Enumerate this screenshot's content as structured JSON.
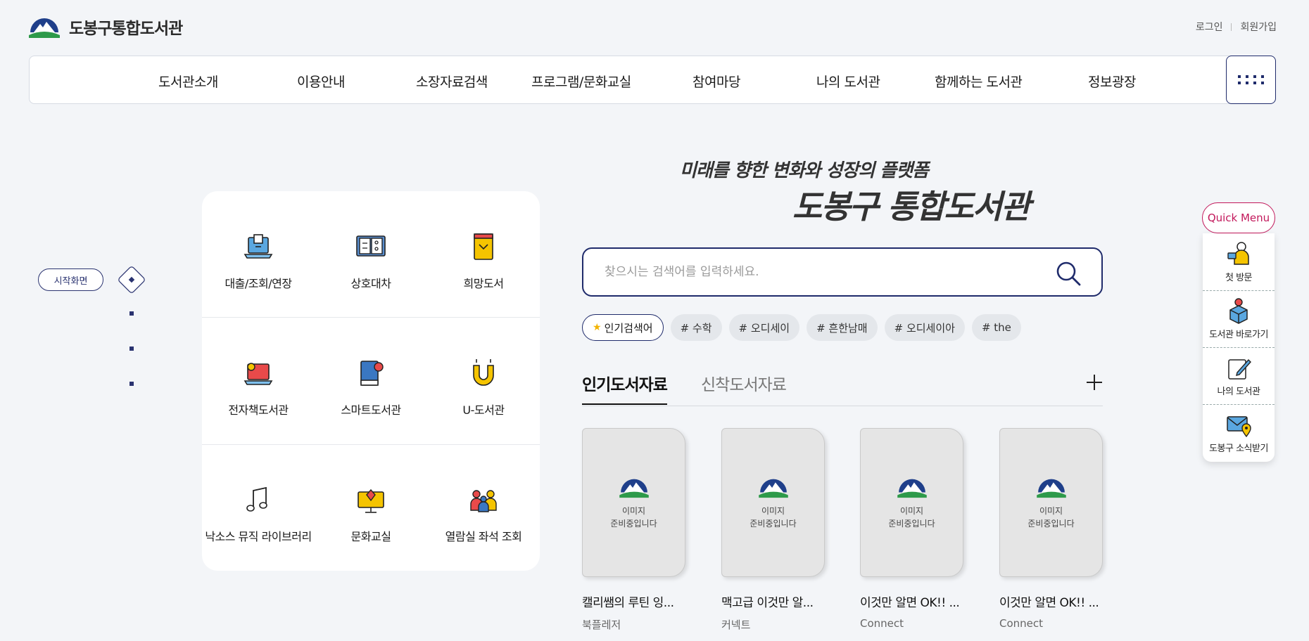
{
  "header": {
    "site_name": "도봉구통합도서관",
    "login": "로그인",
    "signup": "회원가입"
  },
  "gnb": {
    "items": [
      "도서관소개",
      "이용안내",
      "소장자료검색",
      "프로그램/문화교실",
      "참여마당",
      "나의 도서관",
      "함께하는 도서관",
      "정보광장"
    ]
  },
  "indicator": {
    "start_label": "시작화면"
  },
  "services": [
    {
      "label": "대출/조회/연장",
      "icon": "laptop-book-icon"
    },
    {
      "label": "상호대차",
      "icon": "open-book-icon"
    },
    {
      "label": "희망도서",
      "icon": "yellow-book-icon"
    },
    {
      "label": "전자책도서관",
      "icon": "ebook-device-icon"
    },
    {
      "label": "스마트도서관",
      "icon": "smart-book-icon"
    },
    {
      "label": "U-도서관",
      "icon": "magnet-icon"
    },
    {
      "label": "낙소스 뮤직 라이브러리",
      "icon": "music-note-icon"
    },
    {
      "label": "문화교실",
      "icon": "monitor-book-icon"
    },
    {
      "label": "열람실 좌석 조회",
      "icon": "people-icon"
    }
  ],
  "slogan": {
    "line1": "미래를 향한 변화와 성장의 플랫폼",
    "line2": "도봉구 통합도서관"
  },
  "search": {
    "placeholder": "찾으시는 검색어를 입력하세요."
  },
  "tags": {
    "popular_label": "인기검색어",
    "items": [
      "# 수학",
      "# 오디세이",
      "# 흔한남매",
      "# 오디세이아",
      "# the"
    ]
  },
  "tabs": {
    "active": "인기도서자료",
    "inactive": "신착도서자료"
  },
  "books": [
    {
      "title": "캘리쌤의 루틴 잉...",
      "publisher": "북플레저",
      "cover_text": "이미지\n준비중입니다"
    },
    {
      "title": "맥고급 이것만 알...",
      "publisher": "커넥트",
      "cover_text": "이미지\n준비중입니다"
    },
    {
      "title": "이것만 알면 OK!! ...",
      "publisher": "Connect",
      "cover_text": "이미지\n준비중입니다"
    },
    {
      "title": "이것만 알면 OK!! ...",
      "publisher": "Connect",
      "cover_text": "이미지\n준비중입니다"
    }
  ],
  "quick_menu": {
    "title": "Quick Menu",
    "items": [
      {
        "label": "첫 방문",
        "icon": "first-visit-icon"
      },
      {
        "label": "도서관 바로가기",
        "icon": "location-box-icon"
      },
      {
        "label": "나의 도서관",
        "icon": "pen-note-icon"
      },
      {
        "label": "도봉구 소식받기",
        "icon": "mail-pin-icon"
      }
    ]
  },
  "colors": {
    "navy": "#1f2b6b",
    "quick_menu_accent": "#c2185b",
    "star": "#f2b300"
  }
}
